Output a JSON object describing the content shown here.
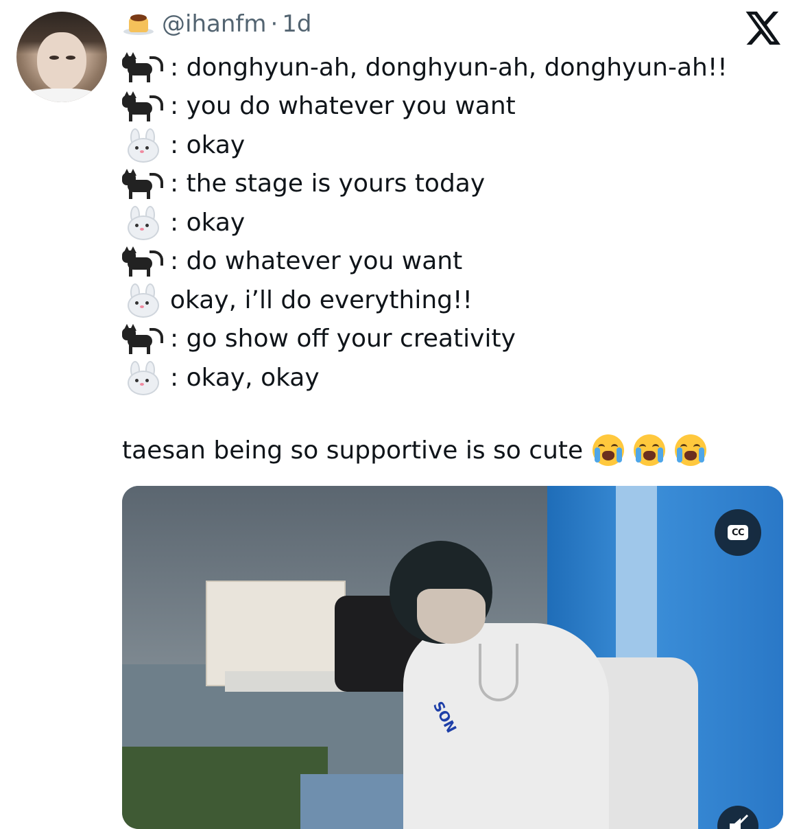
{
  "tweet": {
    "handle": "@ihanfm",
    "separator": "·",
    "time": "1d",
    "handle_emoji": "custard-pudding-emoji",
    "lines": [
      {
        "speaker": "cat",
        "text": ": donghyun-ah, donghyun-ah, donghyun-ah!!"
      },
      {
        "speaker": "cat",
        "text": ": you do whatever you want"
      },
      {
        "speaker": "bunny",
        "text": ": okay"
      },
      {
        "speaker": "cat",
        "text": ": the stage is yours today"
      },
      {
        "speaker": "bunny",
        "text": ": okay"
      },
      {
        "speaker": "cat",
        "text": ": do whatever you want"
      },
      {
        "speaker": "bunny",
        "text": "okay, i’ll do everything!!"
      },
      {
        "speaker": "cat",
        "text": ": go show off your creativity"
      },
      {
        "speaker": "bunny",
        "text": ": okay, okay"
      }
    ],
    "caption": "taesan being so supportive is so cute",
    "caption_emojis": [
      "crying-face-emoji",
      "crying-face-emoji",
      "crying-face-emoji"
    ]
  },
  "media": {
    "cc_label": "CC",
    "shirt_text": "SON"
  },
  "colors": {
    "text": "#0f1419",
    "secondary": "#536471",
    "background": "#ffffff"
  }
}
